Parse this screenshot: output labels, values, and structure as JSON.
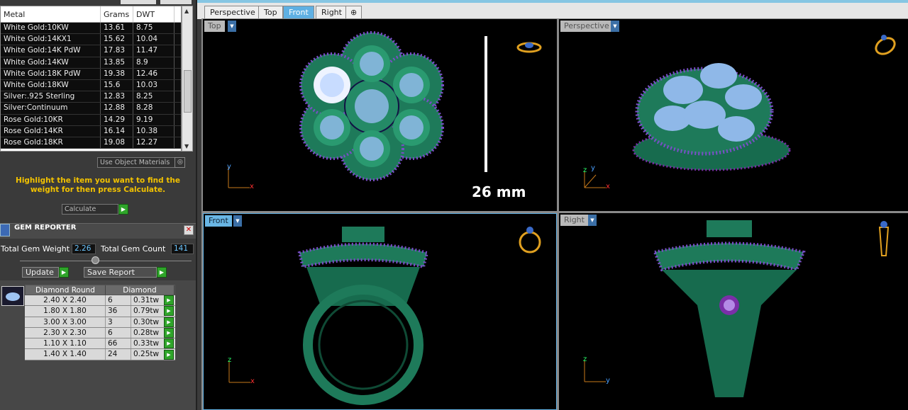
{
  "metal_table": {
    "headers": [
      "Metal",
      "Grams",
      "DWT"
    ],
    "rows": [
      [
        "White Gold:10KW",
        "13.61",
        "8.75"
      ],
      [
        "White Gold:14KX1",
        "15.62",
        "10.04"
      ],
      [
        "White Gold:14K PdW",
        "17.83",
        "11.47"
      ],
      [
        "White Gold:14KW",
        "13.85",
        "8.9"
      ],
      [
        "White Gold:18K PdW",
        "19.38",
        "12.46"
      ],
      [
        "White Gold:18KW",
        "15.6",
        "10.03"
      ],
      [
        "Silver:.925 Sterling",
        "12.83",
        "8.25"
      ],
      [
        "Silver:Continuum",
        "12.88",
        "8.28"
      ],
      [
        "Rose Gold:10KR",
        "14.29",
        "9.19"
      ],
      [
        "Rose Gold:14KR",
        "16.14",
        "10.38"
      ],
      [
        "Rose Gold:18KR",
        "19.08",
        "12.27"
      ]
    ]
  },
  "use_object_materials": "Use Object Materials",
  "hint": "Highlight the item you want to find the weight for then press Calculate.",
  "calculate": "Calculate",
  "gem_reporter": {
    "title": "GEM REPORTER",
    "total_weight_label": "Total Gem Weight",
    "total_weight": "2.26",
    "total_count_label": "Total Gem Count",
    "total_count": "141",
    "update": "Update",
    "save_report": "Save Report",
    "table_headers": [
      "Diamond Round",
      "Diamond"
    ],
    "rows": [
      [
        "2.40 X 2.40",
        "6",
        "0.31tw"
      ],
      [
        "1.80 X 1.80",
        "36",
        "0.79tw"
      ],
      [
        "3.00 X 3.00",
        "3",
        "0.30tw"
      ],
      [
        "2.30 X 2.30",
        "6",
        "0.28tw"
      ],
      [
        "1.10 X 1.10",
        "66",
        "0.33tw"
      ],
      [
        "1.40 X 1.40",
        "24",
        "0.25tw"
      ]
    ]
  },
  "tabs": [
    "Perspective",
    "Top",
    "Front",
    "Right"
  ],
  "active_tab": "Front",
  "viewports": {
    "top": {
      "label": "Top",
      "axes": [
        "y",
        "x"
      ]
    },
    "perspective": {
      "label": "Perspective",
      "axes": [
        "z",
        "y",
        "x"
      ]
    },
    "front": {
      "label": "Front",
      "axes": [
        "z",
        "x"
      ]
    },
    "right": {
      "label": "Right",
      "axes": [
        "z",
        "y"
      ]
    }
  },
  "scale_label": "26 mm",
  "colors": {
    "metal": "#1e7a5a",
    "gem": "#8fb8e8",
    "accent_gem": "#7a2fa8",
    "active": "#5fb0e3"
  }
}
